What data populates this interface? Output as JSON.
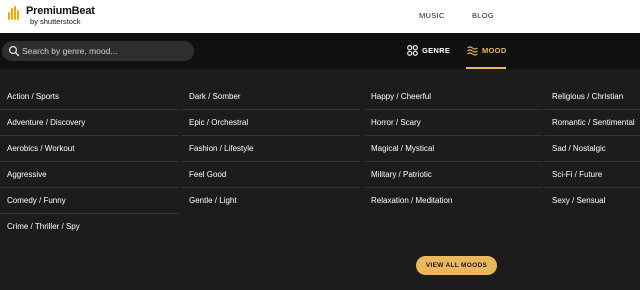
{
  "header": {
    "logo_title": "PremiumBeat",
    "logo_sub": "by shutterstock",
    "nav": [
      "MUSIC",
      "BLOG"
    ]
  },
  "search": {
    "placeholder": "Search by genre, mood..."
  },
  "tabs": [
    {
      "label": "GENRE",
      "icon": "genre-grid-icon",
      "active": false
    },
    {
      "label": "MOOD",
      "icon": "mood-waves-icon",
      "active": true
    }
  ],
  "moods": {
    "col1": [
      "Action / Sports",
      "Adventure / Discovery",
      "Aerobics / Workout",
      "Aggressive",
      "Comedy / Funny",
      "Crime / Thriller / Spy"
    ],
    "col2": [
      "Dark / Somber",
      "Epic / Orchestral",
      "Fashion / Lifestyle",
      "Feel Good",
      "Gentle / Light"
    ],
    "col3": [
      "Happy / Cheerful",
      "Horror / Scary",
      "Magical / Mystical",
      "Military / Patriotic",
      "Relaxation / Meditation"
    ],
    "col4": [
      "Religious / Christian",
      "Romantic / Sentimental",
      "Sad / Nostalgic",
      "Sci-Fi / Future",
      "Sexy / Sensual"
    ]
  },
  "view_all_label": "VIEW ALL MOODS",
  "colors": {
    "accent": "#e8b85a",
    "logo_bars": "#f2a900",
    "background": "#1c1c1c"
  }
}
